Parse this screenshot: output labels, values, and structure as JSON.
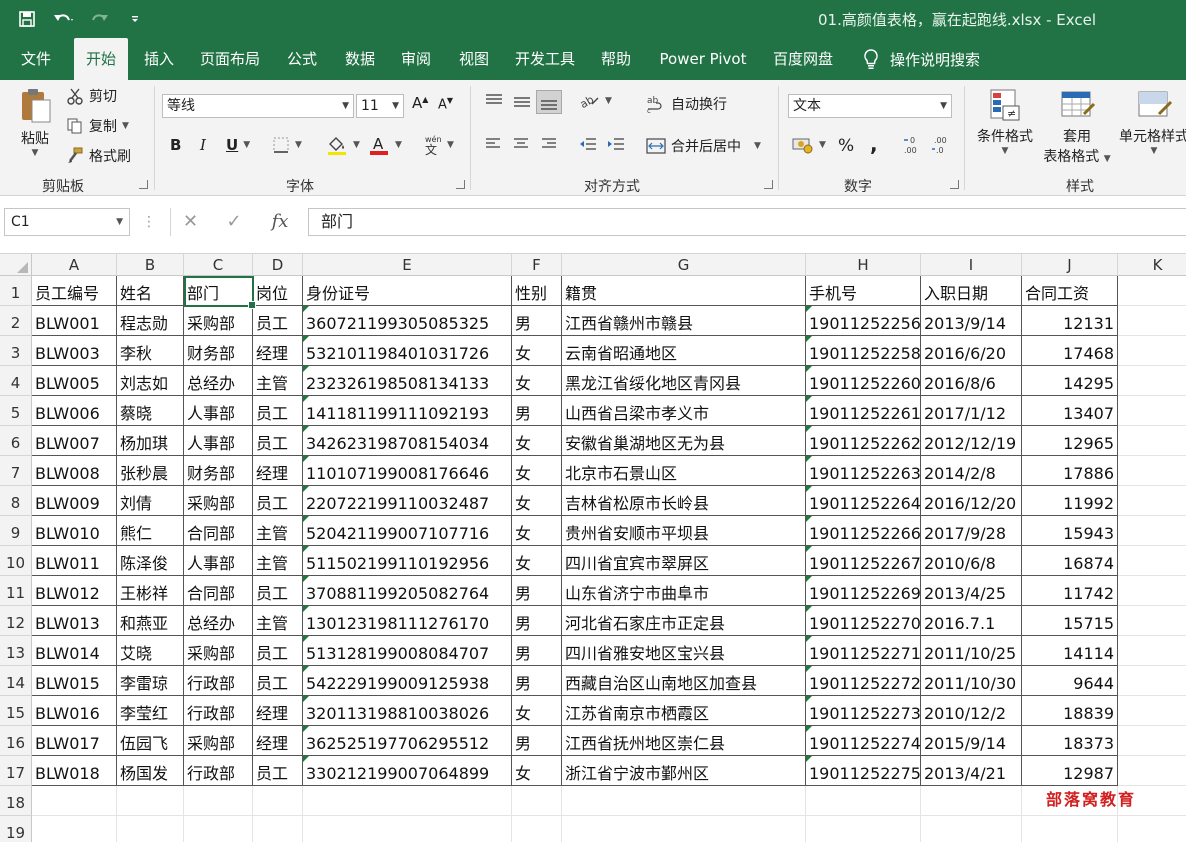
{
  "window": {
    "title": "01.高颜值表格，赢在起跑线.xlsx  -  Excel"
  },
  "ribbon_tabs": [
    "文件",
    "开始",
    "插入",
    "页面布局",
    "公式",
    "数据",
    "审阅",
    "视图",
    "开发工具",
    "帮助",
    "Power Pivot",
    "百度网盘"
  ],
  "active_tab": "开始",
  "tell_me": "操作说明搜索",
  "clipboard": {
    "paste": "粘贴",
    "cut": "剪切",
    "copy": "复制",
    "format_painter": "格式刷",
    "label": "剪贴板"
  },
  "font": {
    "name": "等线",
    "size": "11",
    "label": "字体"
  },
  "alignment": {
    "wrap_text": "自动换行",
    "merge_center": "合并后居中",
    "label": "对齐方式"
  },
  "number": {
    "format": "文本",
    "percent": "%",
    "comma": ",",
    "label": "数字"
  },
  "styles": {
    "conditional_format": "条件格式",
    "format_as_table_1": "套用",
    "format_as_table_2": "表格格式",
    "cell_styles": "单元格样式",
    "label": "样式"
  },
  "formula_bar": {
    "name_box": "C1",
    "content": "部门"
  },
  "columns": [
    "A",
    "B",
    "C",
    "D",
    "E",
    "F",
    "G",
    "H",
    "I",
    "J",
    "K"
  ],
  "headers": [
    "员工编号",
    "姓名",
    "部门",
    "岗位",
    "身份证号",
    "性别",
    "籍贯",
    "手机号",
    "入职日期",
    "合同工资"
  ],
  "rows": [
    [
      "BLW001",
      "程志勋",
      "采购部",
      "员工",
      "360721199305085325",
      "男",
      "江西省赣州市赣县",
      "19011252256",
      "2013/9/14",
      "12131"
    ],
    [
      "BLW003",
      "李秋",
      "财务部",
      "经理",
      "532101198401031726",
      "女",
      "云南省昭通地区",
      "19011252258",
      "2016/6/20",
      "17468"
    ],
    [
      "BLW005",
      "刘志如",
      "总经办",
      "主管",
      "232326198508134133",
      "女",
      "黑龙江省绥化地区青冈县",
      "19011252260",
      "2016/8/6",
      "14295"
    ],
    [
      "BLW006",
      "蔡晓",
      "人事部",
      "员工",
      "141181199111092193",
      "男",
      "山西省吕梁市孝义市",
      "19011252261",
      "2017/1/12",
      "13407"
    ],
    [
      "BLW007",
      "杨加琪",
      "人事部",
      "员工",
      "342623198708154034",
      "女",
      "安徽省巢湖地区无为县",
      "19011252262",
      "2012/12/19",
      "12965"
    ],
    [
      "BLW008",
      "张秒晨",
      "财务部",
      "经理",
      "110107199008176646",
      "女",
      "北京市石景山区",
      "19011252263",
      "2014/2/8",
      "17886"
    ],
    [
      "BLW009",
      "刘倩",
      "采购部",
      "员工",
      "220722199110032487",
      "女",
      "吉林省松原市长岭县",
      "19011252264",
      "2016/12/20",
      "11992"
    ],
    [
      "BLW010",
      "熊仁",
      "合同部",
      "主管",
      "520421199007107716",
      "女",
      "贵州省安顺市平坝县",
      "19011252266",
      "2017/9/28",
      "15943"
    ],
    [
      "BLW011",
      "陈泽俊",
      "人事部",
      "主管",
      "511502199110192956",
      "女",
      "四川省宜宾市翠屏区",
      "19011252267",
      "2010/6/8",
      "16874"
    ],
    [
      "BLW012",
      "王彬祥",
      "合同部",
      "员工",
      "370881199205082764",
      "男",
      "山东省济宁市曲阜市",
      "19011252269",
      "2013/4/25",
      "11742"
    ],
    [
      "BLW013",
      "和燕亚",
      "总经办",
      "主管",
      "130123198111276170",
      "男",
      "河北省石家庄市正定县",
      "19011252270",
      "2016.7.1",
      "15715"
    ],
    [
      "BLW014",
      "艾晓",
      "采购部",
      "员工",
      "513128199008084707",
      "男",
      "四川省雅安地区宝兴县",
      "19011252271",
      "2011/10/25",
      "14114"
    ],
    [
      "BLW015",
      "李雷琼",
      "行政部",
      "员工",
      "542229199009125938",
      "男",
      "西藏自治区山南地区加查县",
      "19011252272",
      "2011/10/30",
      "9644"
    ],
    [
      "BLW016",
      "李莹红",
      "行政部",
      "经理",
      "320113198810038026",
      "女",
      "江苏省南京市栖霞区",
      "19011252273",
      "2010/12/2",
      "18839"
    ],
    [
      "BLW017",
      "伍园飞",
      "采购部",
      "经理",
      "362525197706295512",
      "男",
      "江西省抚州地区崇仁县",
      "19011252274",
      "2015/9/14",
      "18373"
    ],
    [
      "BLW018",
      "杨国发",
      "行政部",
      "员工",
      "330212199007064899",
      "女",
      "浙江省宁波市鄞州区",
      "19011252275",
      "2013/4/21",
      "12987"
    ]
  ],
  "row_numbers": [
    "1",
    "2",
    "3",
    "4",
    "5",
    "6",
    "7",
    "8",
    "9",
    "10",
    "11",
    "12",
    "13",
    "14",
    "15",
    "16",
    "17",
    "18",
    "19"
  ],
  "watermark": "部落窝教育",
  "colors": {
    "excel_green": "#217346",
    "font_color_bar": "#e02020",
    "fill_color_bar": "#f2e600",
    "watermark": "#d21f1f"
  }
}
